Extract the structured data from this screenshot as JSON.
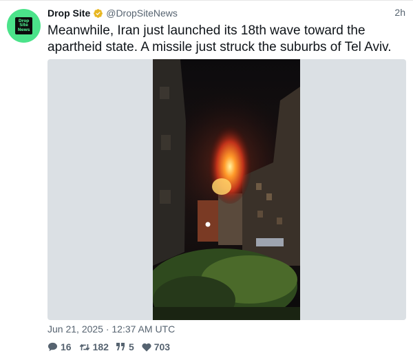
{
  "account": {
    "name": "Drop Site",
    "handle": "@DropSiteNews",
    "avatar_text": [
      "Drop",
      "Site",
      "News"
    ],
    "avatar_color": "#4be38a",
    "verified_color": "#e8b722"
  },
  "tweet": {
    "relative_time": "2h",
    "text": "Meanwhile, Iran just launched its 18th wave toward the apartheid state. A missile just struck the suburbs of Tel Aviv.",
    "date": "Jun 21, 2025 · 12:37 AM UTC"
  },
  "stats": {
    "replies": "16",
    "retweets": "182",
    "quotes": "5",
    "likes": "703"
  },
  "icons": {
    "reply": "speech-bubble-icon",
    "retweet": "retweet-icon",
    "quote": "quote-icon",
    "like": "heart-icon",
    "verified": "verified-badge-icon"
  }
}
